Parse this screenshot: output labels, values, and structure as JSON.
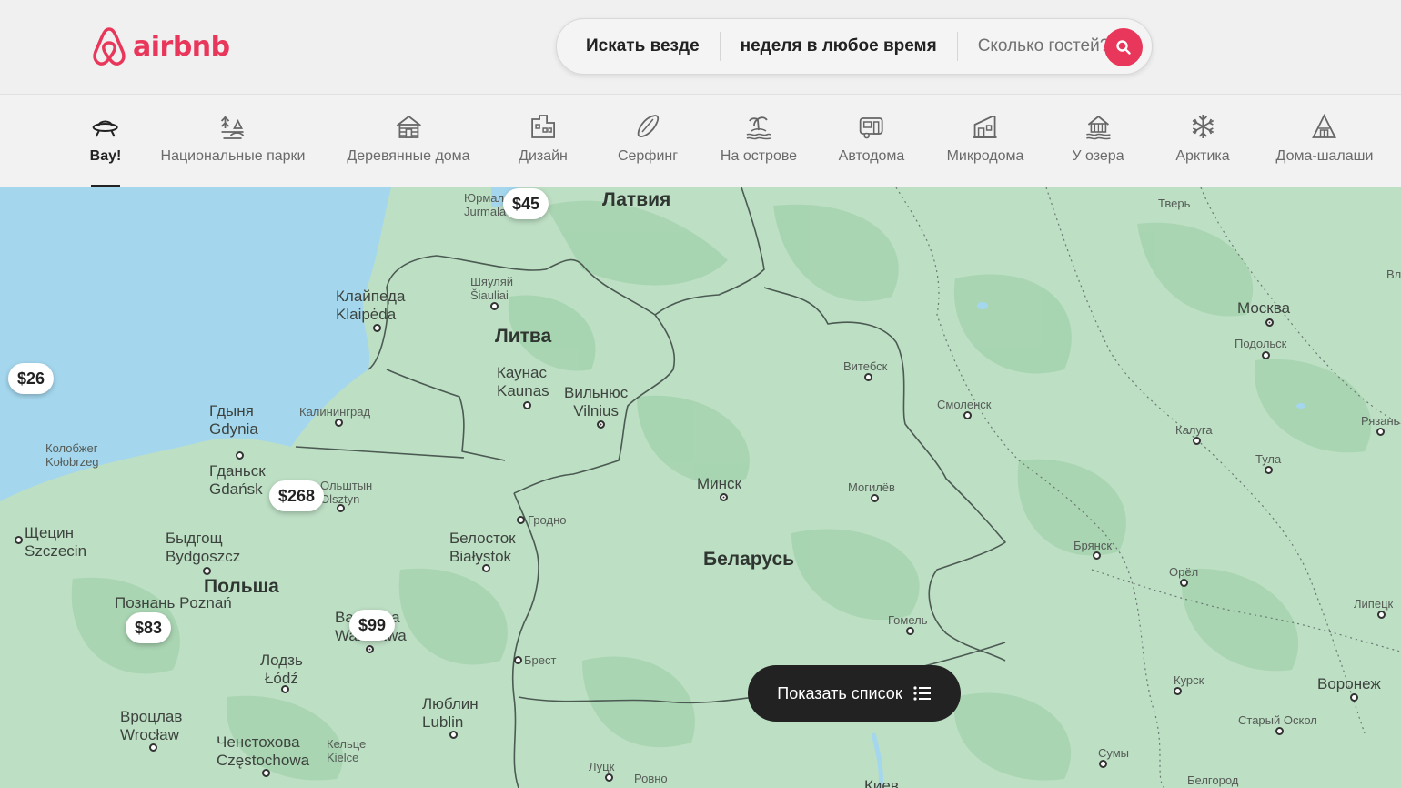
{
  "header": {
    "logo_text": "airbnb",
    "brand_color": "#e8375a",
    "search": {
      "where": "Искать везде",
      "when": "неделя в любое время",
      "guests": "Сколько гостей?",
      "button_icon": "search-icon"
    }
  },
  "categories": [
    {
      "label": "Вау!",
      "icon": "ufo-icon",
      "active": true
    },
    {
      "label": "Национальные парки",
      "icon": "park-icon",
      "active": false
    },
    {
      "label": "Деревянные дома",
      "icon": "cabin-icon",
      "active": false
    },
    {
      "label": "Дизайн",
      "icon": "design-icon",
      "active": false
    },
    {
      "label": "Серфинг",
      "icon": "surfboard-icon",
      "active": false
    },
    {
      "label": "На острове",
      "icon": "island-icon",
      "active": false
    },
    {
      "label": "Автодома",
      "icon": "camper-icon",
      "active": false
    },
    {
      "label": "Микродома",
      "icon": "tiny-home-icon",
      "active": false
    },
    {
      "label": "У озера",
      "icon": "lake-icon",
      "active": false
    },
    {
      "label": "Арктика",
      "icon": "snowflake-icon",
      "active": false
    },
    {
      "label": "Дома-шалаши",
      "icon": "a-frame-icon",
      "active": false
    }
  ],
  "map": {
    "countries": {
      "latvia": "Латвия",
      "lithuania": "Литва",
      "belarus": "Беларусь",
      "poland": "Польша"
    },
    "cities": {
      "jurmala": "Юрмала\nJurmala",
      "tver": "Тверь",
      "siauliai": "Шяуляй\nŠiauliai",
      "klaipeda": "Клайпеда\nKlaipėda",
      "moscow": "Москва",
      "podolsk": "Подольск",
      "kaunas": "Каунас\nKaunas",
      "vilnius": "Вильнюс\nVilnius",
      "vitebsk": "Витебск",
      "gdynia": "Гдыня\nGdynia",
      "kaliningrad": "Калининград",
      "smolensk": "Смоленск",
      "kaluga": "Калуга",
      "ryazan": "Рязань",
      "kolobrzeg": "Колобжег\nKołobrzeg",
      "gdansk": "Гданьск\nGdańsk",
      "olsztyn": "Ольштын\nOlsztyn",
      "minsk": "Минск",
      "mogilev": "Могилёв",
      "tula": "Тула",
      "grodno": "Гродно",
      "szczecin": "Щецин\nSzczecin",
      "bydgoszcz": "Быдгощ\nBydgoszcz",
      "bialystok": "Белосток\nBiałystok",
      "bryansk": "Брянск",
      "orel": "Орёл",
      "lipetsk": "Липецк",
      "poznan": "Познань\nPoznań",
      "warszawa": "Варшава\nWarszawa",
      "gomel": "Гомель",
      "lodz": "Лодзь\nŁódź",
      "brest": "Брест",
      "kursk": "Курск",
      "voronezh": "Воронеж",
      "lublin": "Люблин\nLublin",
      "wroclaw": "Вроцлав\nWrocław",
      "starly_oskol": "Старый Оскол",
      "czestochowa": "Ченстохова\nCzęstochowa",
      "kielce": "Кельце\nKielce",
      "sumy": "Сумы",
      "lutsk": "Луцк",
      "rovno": "Ровно",
      "kiev": "Киев",
      "belgorod": "Белгород"
    },
    "prices": [
      {
        "id": "p45",
        "text": "$45"
      },
      {
        "id": "p26",
        "text": "$26"
      },
      {
        "id": "p268",
        "text": "$268"
      },
      {
        "id": "p83",
        "text": "$83"
      },
      {
        "id": "p99",
        "text": "$99"
      }
    ],
    "colors": {
      "land": "#bddfc4",
      "forest": "#a6d4b0",
      "water": "#a4d7ee",
      "border": "#4b5a52"
    }
  },
  "show_list": {
    "label": "Показать список",
    "icon": "list-icon"
  }
}
